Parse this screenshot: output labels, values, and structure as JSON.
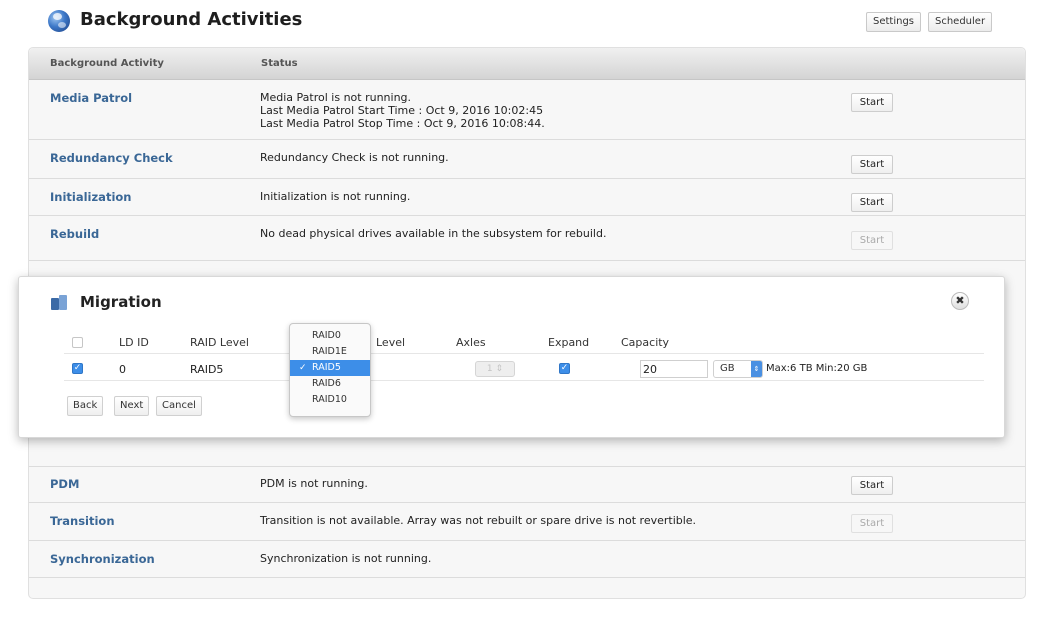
{
  "header": {
    "title": "Background Activities",
    "settings_label": "Settings",
    "scheduler_label": "Scheduler"
  },
  "table": {
    "col_activity": "Background Activity",
    "col_status": "Status",
    "rows": [
      {
        "name": "Media Patrol",
        "status": [
          "Media Patrol is not running.",
          "Last Media Patrol Start Time : Oct 9, 2016 10:02:45",
          "Last Media Patrol Stop Time : Oct 9, 2016 10:08:44."
        ],
        "action": "Start",
        "enabled": true
      },
      {
        "name": "Redundancy Check",
        "status": [
          "Redundancy Check is not running."
        ],
        "action": "Start",
        "enabled": true
      },
      {
        "name": "Initialization",
        "status": [
          "Initialization is not running."
        ],
        "action": "Start",
        "enabled": true
      },
      {
        "name": "Rebuild",
        "status": [
          "No dead physical drives available in the subsystem for rebuild."
        ],
        "action": "Start",
        "enabled": false
      },
      {
        "name": "PDM",
        "status": [
          "PDM is not running."
        ],
        "action": "Start",
        "enabled": true
      },
      {
        "name": "Transition",
        "status": [
          "Transition is not available. Array was not rebuilt or spare drive is not revertible."
        ],
        "action": "Start",
        "enabled": false
      },
      {
        "name": "Synchronization",
        "status": [
          "Synchronization is not running."
        ],
        "action": "",
        "enabled": false
      }
    ]
  },
  "migration": {
    "title": "Migration",
    "close_icon": "close-icon",
    "columns": {
      "ld_id": "LD ID",
      "raid_level": "RAID Level",
      "new_level": "Level",
      "axles": "Axles",
      "expand": "Expand",
      "capacity": "Capacity"
    },
    "row": {
      "selected": true,
      "ld_id": "0",
      "raid_level": "RAID5",
      "axles_value": "1",
      "expand": true,
      "capacity_value": "20",
      "unit": "GB",
      "max_min": "Max:6 TB Min:20 GB"
    },
    "raid_options": [
      "RAID0",
      "RAID1E",
      "RAID5",
      "RAID6",
      "RAID10"
    ],
    "raid_selected": "RAID5",
    "buttons": {
      "back": "Back",
      "next": "Next",
      "cancel": "Cancel"
    }
  },
  "colors": {
    "link": "#3a6796",
    "accent": "#3d8ee8"
  }
}
